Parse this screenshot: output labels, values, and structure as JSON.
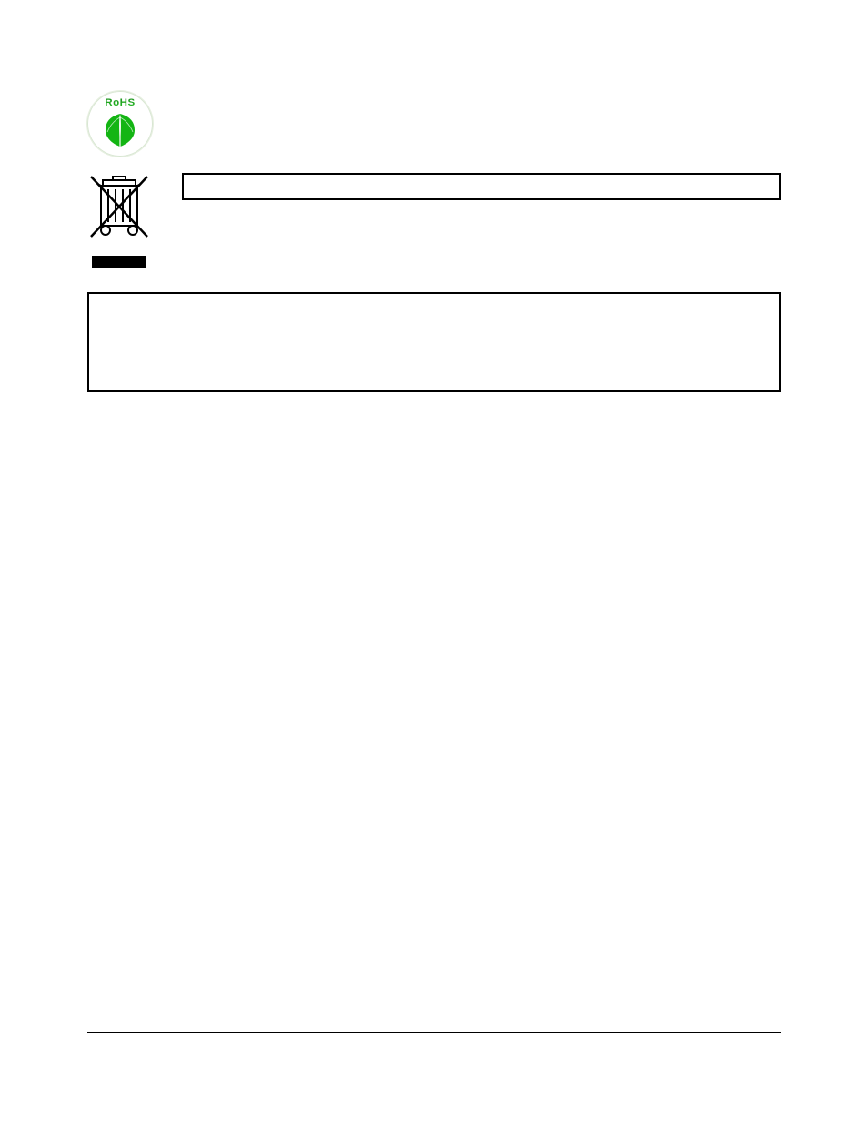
{
  "header": {
    "title": ""
  },
  "icons": {
    "rohs_label": "RoHS",
    "weee_alt": "weee-bin-icon"
  },
  "boxes": {
    "weee_caption": "",
    "ce_warning": ""
  }
}
